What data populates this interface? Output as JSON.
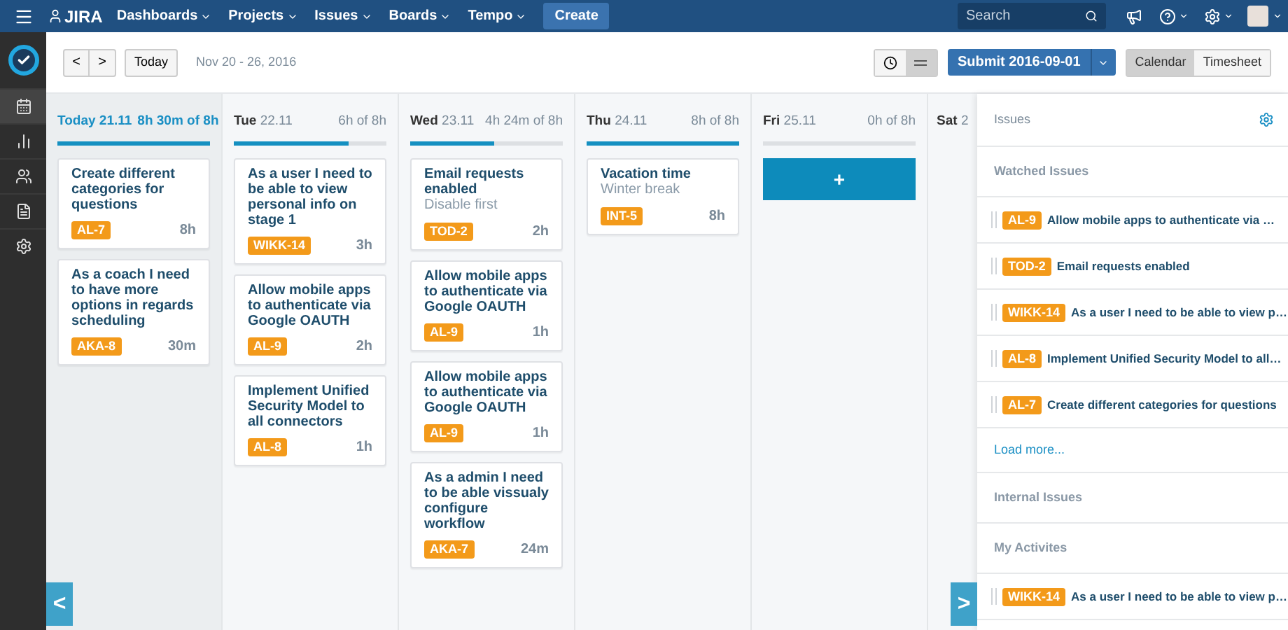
{
  "nav": {
    "logo": "JIRA",
    "menus": [
      {
        "label": "Dashboards"
      },
      {
        "label": "Projects"
      },
      {
        "label": "Issues"
      },
      {
        "label": "Boards"
      },
      {
        "label": "Tempo"
      }
    ],
    "create": "Create",
    "search": {
      "placeholder": "Search"
    }
  },
  "toolbar": {
    "prev": "<",
    "next": ">",
    "today": "Today",
    "range": "Nov 20 - 26, 2016",
    "view_modes": [
      {
        "kind": "clock",
        "selected": false
      },
      {
        "kind": "list",
        "selected": true
      }
    ],
    "submit": "Submit 2016-09-01",
    "tabs": [
      {
        "label": "Calendar",
        "selected": true
      },
      {
        "label": "Timesheet",
        "selected": false
      }
    ]
  },
  "days": [
    {
      "day": "Today",
      "date": "21.11",
      "total": "8h 30m of 8h",
      "level": 1,
      "selected": true,
      "cards": [
        {
          "title": "Create different categories for questions",
          "key": "AL-7",
          "time": "8h"
        },
        {
          "title": "As a coach I need to have more options in regards scheduling",
          "key": "AKA-8",
          "time": "30m"
        }
      ]
    },
    {
      "day": "Tue",
      "date": "22.11",
      "total": "6h of 8h",
      "level": 0.75,
      "selected": false,
      "cards": [
        {
          "title": "As a user I need to be able to view personal info on stage 1",
          "key": "WIKK-14",
          "time": "3h"
        },
        {
          "title": "Allow mobile apps to authenticate via Google OAUTH",
          "key": "AL-9",
          "time": "2h"
        },
        {
          "title": "Implement Unified Security Model to all connectors",
          "key": "AL-8",
          "time": "1h"
        }
      ]
    },
    {
      "day": "Wed",
      "date": "23.11",
      "total": "4h 24m of 8h",
      "level": 0.55,
      "selected": false,
      "cards": [
        {
          "title": "Email requests enabled",
          "description": "Disable first",
          "key": "TOD-2",
          "time": "2h"
        },
        {
          "title": "Allow mobile apps to authenticate via Google OAUTH",
          "key": "AL-9",
          "time": "1h"
        },
        {
          "title": "Allow mobile apps to authenticate via Google OAUTH",
          "key": "AL-9",
          "time": "1h"
        },
        {
          "title": "As a admin I need to be able vissualy configure workflow",
          "key": "AKA-7",
          "time": "24m"
        }
      ]
    },
    {
      "day": "Thu",
      "date": "24.11",
      "total": "8h of 8h",
      "level": 1,
      "selected": false,
      "cards": [
        {
          "title": "Vacation time",
          "description": "Winter break",
          "key": "INT-5",
          "time": "8h"
        }
      ]
    },
    {
      "day": "Fri",
      "date": "25.11",
      "total": "0h of 8h",
      "level": 0,
      "selected": false,
      "add": "+"
    },
    {
      "day": "Sat",
      "date": "2",
      "selected": false
    }
  ],
  "scroll_left": "<",
  "scroll_right": ">",
  "panel": {
    "title": "Issues",
    "sections": [
      {
        "title": "Watched Issues",
        "items": [
          {
            "key": "AL-9",
            "title": "Allow mobile apps to authenticate via …"
          },
          {
            "key": "TOD-2",
            "title": "Email requests enabled"
          },
          {
            "key": "WIKK-14",
            "title": "As a user I need to be able to view p…"
          },
          {
            "key": "AL-8",
            "title": "Implement Unified Security Model to all…"
          },
          {
            "key": "AL-7",
            "title": "Create different categories for questions"
          }
        ],
        "load_more": "Load more..."
      },
      {
        "title": "Internal Issues"
      },
      {
        "title": "My Activites",
        "items": [
          {
            "key": "WIKK-14",
            "title": "As a user I need to be able to view p…"
          }
        ]
      }
    ]
  }
}
